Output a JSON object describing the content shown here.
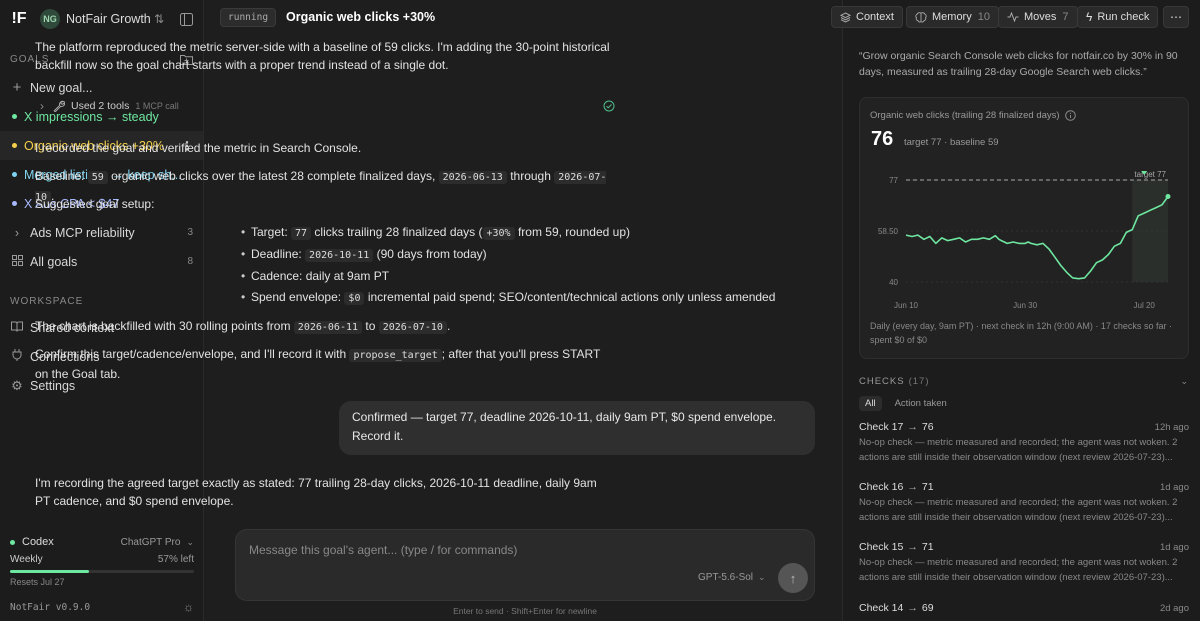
{
  "workspace": {
    "logo": "!F",
    "badge": "NG",
    "name": "NotFair Growth"
  },
  "sidebar": {
    "goals_label": "GOALS",
    "new_goal": "New goal...",
    "goals": [
      {
        "label": "X impressions → steady",
        "color": "#6ee7a0"
      },
      {
        "label": "Organic web clicks +30%",
        "color": "#f4d04a"
      },
      {
        "label": "Merged listings → keep sh...",
        "color": "#7fd3f0"
      },
      {
        "label": "X Ads CPA < $47",
        "color": "#a8b8ff"
      }
    ],
    "ads_mcp": {
      "label": "Ads MCP reliability",
      "count": "3"
    },
    "all_goals": {
      "label": "All goals",
      "count": "8"
    },
    "workspace_label": "WORKSPACE",
    "workspace_items": [
      "Shared context",
      "Connections",
      "Settings"
    ]
  },
  "codex": {
    "name": "Codex",
    "plan": "ChatGPT Pro",
    "weekly": "Weekly",
    "left": "57% left",
    "used_fraction": 0.43,
    "resets": "Resets Jul 27",
    "version": "NotFair v0.9.0"
  },
  "header": {
    "status": "running",
    "title": "Organic web clicks +30%"
  },
  "toolbar": {
    "context": "Context",
    "memory": "Memory",
    "memory_count": "10",
    "moves": "Moves",
    "moves_count": "7",
    "run": "Run check"
  },
  "chat": {
    "p1": "The platform reproduced the metric server-side with a baseline of 59 clicks. I'm adding the 30-point historical backfill now so the goal chart starts with a proper trend instead of a single dot.",
    "tools": "Used 2 tools",
    "tools_sub": "1 MCP call",
    "p2": "I recorded the goal and verified the metric in Search Console.",
    "baseline_a": "Baseline:",
    "baseline_v": "59",
    "baseline_b": "organic web clicks over the latest 28 complete finalized days,",
    "d1": "2026-06-13",
    "through": "through",
    "d2": "2026-07-10",
    "dot": ".",
    "suggested": "Suggested goal setup:",
    "b1a": "Target:",
    "b1v": "77",
    "b1b": "clicks trailing 28 finalized days (",
    "b1c": "+30%",
    "b1d": "from 59, rounded up)",
    "b2a": "Deadline:",
    "b2v": "2026-10-11",
    "b2b": "(90 days from today)",
    "b3": "Cadence: daily at 9am PT",
    "b4a": "Spend envelope:",
    "b4v": "$0",
    "b4b": "incremental paid spend; SEO/content/technical actions only unless amended",
    "p3a": "The chart is backfilled with 30 rolling points from",
    "p3d1": "2026-06-11",
    "p3to": "to",
    "p3d2": "2026-07-10",
    "p3e": ".",
    "p4a": "Confirm this target/cadence/envelope, and I'll record it with",
    "p4c": "propose_target",
    "p4b": "; after that you'll press START on the Goal tab.",
    "user": "Confirmed — target 77, deadline 2026-10-11, daily 9am PT, $0 spend envelope. Record it.",
    "p5": "I'm recording the agreed target exactly as stated: 77 trailing 28-day clicks, 2026-10-11 deadline, daily 9am PT cadence, and $0 spend envelope."
  },
  "composer": {
    "placeholder": "Message this goal's agent...  (type / for commands)",
    "model": "GPT-5.6-Sol",
    "hint": "Enter to send · Shift+Enter for newline"
  },
  "goal_quote": "“Grow organic Search Console web clicks for notfair.co by 30% in 90 days, measured as trailing 28-day Google Search web clicks.”",
  "card": {
    "label": "Organic web clicks (trailing 28 finalized days)",
    "value": "76",
    "meta": "target 77 · baseline 59",
    "target_label": "target 77",
    "footer": "Daily (every day, 9am PT) · next check in 12h (9:00 AM) · 17 checks so far · spent $0 of $0"
  },
  "chart_data": {
    "type": "line",
    "x_ticks": [
      "Jun 10",
      "Jun 30",
      "Jul 20"
    ],
    "y_ticks": [
      "77",
      "58.50",
      "40"
    ],
    "ylim": [
      40,
      77
    ],
    "target": 77,
    "x": [
      0,
      1,
      2,
      3,
      4,
      5,
      6,
      7,
      8,
      9,
      10,
      11,
      12,
      13,
      14,
      15,
      15.6,
      16,
      16.5,
      17,
      18,
      19,
      20,
      20.5,
      21,
      22,
      23,
      24,
      25,
      26,
      27,
      28,
      29,
      30,
      31,
      32,
      33,
      34,
      35,
      36,
      37,
      38,
      39,
      40,
      41,
      42,
      43,
      44
    ],
    "values": [
      57,
      56.5,
      57,
      55.5,
      56.5,
      54,
      56,
      55,
      55.5,
      56,
      54.5,
      55.5,
      55.5,
      56,
      55.5,
      56.8,
      55.5,
      55,
      54.5,
      54,
      54.5,
      54,
      54,
      54.5,
      54,
      53.5,
      54,
      52,
      49,
      46,
      43.5,
      41.5,
      41.2,
      41.5,
      44,
      47,
      48,
      50,
      53,
      54,
      58,
      59,
      64,
      65,
      66,
      67,
      68,
      71
    ],
    "grid": true
  },
  "checks": {
    "title": "CHECKS",
    "count": "(17)",
    "filters": [
      "All",
      "Action taken"
    ],
    "items": [
      {
        "label": "Check 17",
        "value": "76",
        "time": "12h ago",
        "desc": "No-op check — metric measured and recorded; the agent was not woken. 2 actions are still inside their observation window (next review 2026-07-23)..."
      },
      {
        "label": "Check 16",
        "value": "71",
        "time": "1d ago",
        "desc": "No-op check — metric measured and recorded; the agent was not woken. 2 actions are still inside their observation window (next review 2026-07-23)..."
      },
      {
        "label": "Check 15",
        "value": "71",
        "time": "1d ago",
        "desc": "No-op check — metric measured and recorded; the agent was not woken. 2 actions are still inside their observation window (next review 2026-07-23)..."
      },
      {
        "label": "Check 14",
        "value": "69",
        "time": "2d ago",
        "desc": ""
      }
    ]
  }
}
